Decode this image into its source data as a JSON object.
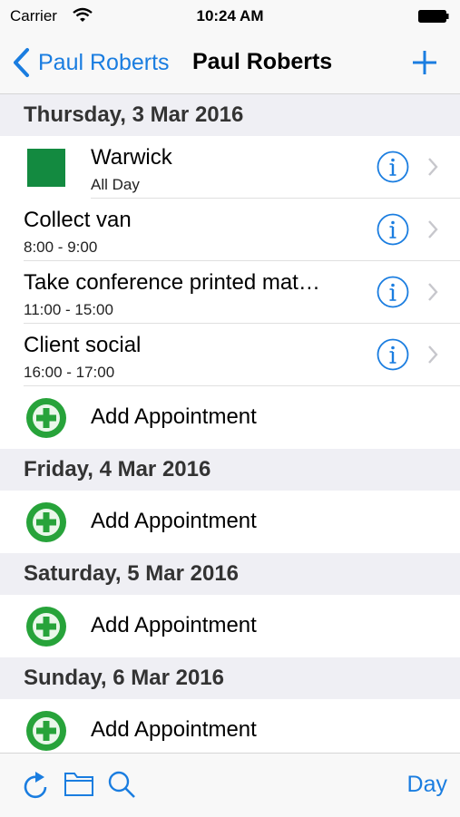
{
  "status_bar": {
    "carrier": "Carrier",
    "time": "10:24 AM"
  },
  "nav": {
    "back_label": "Paul Roberts",
    "title": "Paul Roberts"
  },
  "colors": {
    "accent": "#1a7de0",
    "swatch": "#138a40",
    "add_green": "#27a33a"
  },
  "days": [
    {
      "header": "Thursday, 3 Mar 2016",
      "appointments": [
        {
          "title": "Warwick",
          "time": "All Day",
          "has_swatch": true
        },
        {
          "title": "Collect van",
          "time": "8:00 - 9:00"
        },
        {
          "title": "Take conference printed mat…",
          "time": "11:00 - 15:00"
        },
        {
          "title": "Client social",
          "time": "16:00 - 17:00"
        }
      ],
      "add_label": "Add Appointment"
    },
    {
      "header": "Friday, 4 Mar 2016",
      "add_label": "Add Appointment"
    },
    {
      "header": "Saturday, 5 Mar 2016",
      "add_label": "Add Appointment"
    },
    {
      "header": "Sunday, 6 Mar 2016",
      "add_label": "Add Appointment"
    }
  ],
  "toolbar": {
    "icons": [
      "refresh-icon",
      "folder-icon",
      "search-icon"
    ],
    "day_label": "Day"
  }
}
